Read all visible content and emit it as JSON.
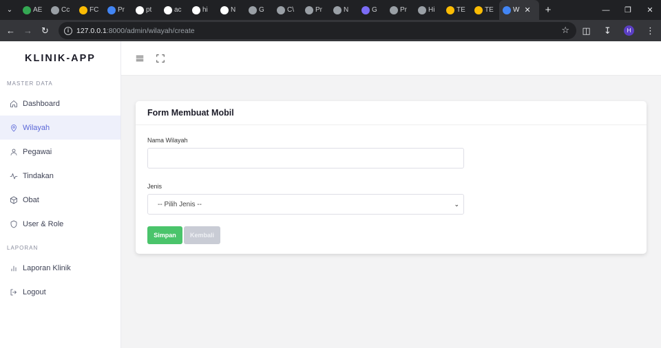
{
  "browser": {
    "tabs": [
      {
        "label": "AE",
        "icon": "sheets-icon",
        "color": "#34a853"
      },
      {
        "label": "Cc",
        "icon": "globe-icon",
        "color": "#9aa0a6"
      },
      {
        "label": "FC",
        "icon": "drive-icon",
        "color": "#fbbc04"
      },
      {
        "label": "Pr",
        "icon": "docs-icon",
        "color": "#4285f4"
      },
      {
        "label": "pt",
        "icon": "google-icon",
        "color": "#ffffff"
      },
      {
        "label": "ac",
        "icon": "google-icon",
        "color": "#ffffff"
      },
      {
        "label": "hi",
        "icon": "github-icon",
        "color": "#ffffff"
      },
      {
        "label": "N",
        "icon": "google-icon",
        "color": "#ffffff"
      },
      {
        "label": "G",
        "icon": "gear-globe-icon",
        "color": "#9aa0a6"
      },
      {
        "label": "C\\",
        "icon": "globe-icon",
        "color": "#9aa0a6"
      },
      {
        "label": "Pr",
        "icon": "globe-icon",
        "color": "#9aa0a6"
      },
      {
        "label": "N",
        "icon": "chrome-icon",
        "color": "#9aa0a6"
      },
      {
        "label": "G",
        "icon": "gemini-icon",
        "color": "#7b6cf6"
      },
      {
        "label": "Pr",
        "icon": "globe-icon",
        "color": "#9aa0a6"
      },
      {
        "label": "Hi",
        "icon": "globe-icon",
        "color": "#9aa0a6"
      },
      {
        "label": "TE",
        "icon": "drive-icon",
        "color": "#fbbc04"
      },
      {
        "label": "TE",
        "icon": "drive-icon",
        "color": "#fbbc04"
      },
      {
        "label": "W",
        "icon": "docs-icon",
        "color": "#4285f4"
      }
    ],
    "url_host": "127.0.0.1",
    "url_rest": ":8000/admin/wilayah/create",
    "profile_initial": "H"
  },
  "sidebar": {
    "brand": "KLINIK-APP",
    "section_master": "MASTER DATA",
    "items": [
      {
        "label": "Dashboard"
      },
      {
        "label": "Wilayah"
      },
      {
        "label": "Pegawai"
      },
      {
        "label": "Tindakan"
      },
      {
        "label": "Obat"
      },
      {
        "label": "User & Role"
      }
    ],
    "section_laporan": "LAPORAN",
    "items2": [
      {
        "label": "Laporan Klinik"
      },
      {
        "label": "Logout"
      }
    ]
  },
  "form": {
    "title": "Form Membuat Mobil",
    "nama_label": "Nama Wilayah",
    "nama_value": "",
    "jenis_label": "Jenis",
    "jenis_selected": "-- Pilih Jenis --",
    "save_label": "Simpan",
    "back_label": "Kembali"
  },
  "colors": {
    "accent": "#5a67d8",
    "save": "#4ac46b",
    "back": "#c9ccd5"
  }
}
